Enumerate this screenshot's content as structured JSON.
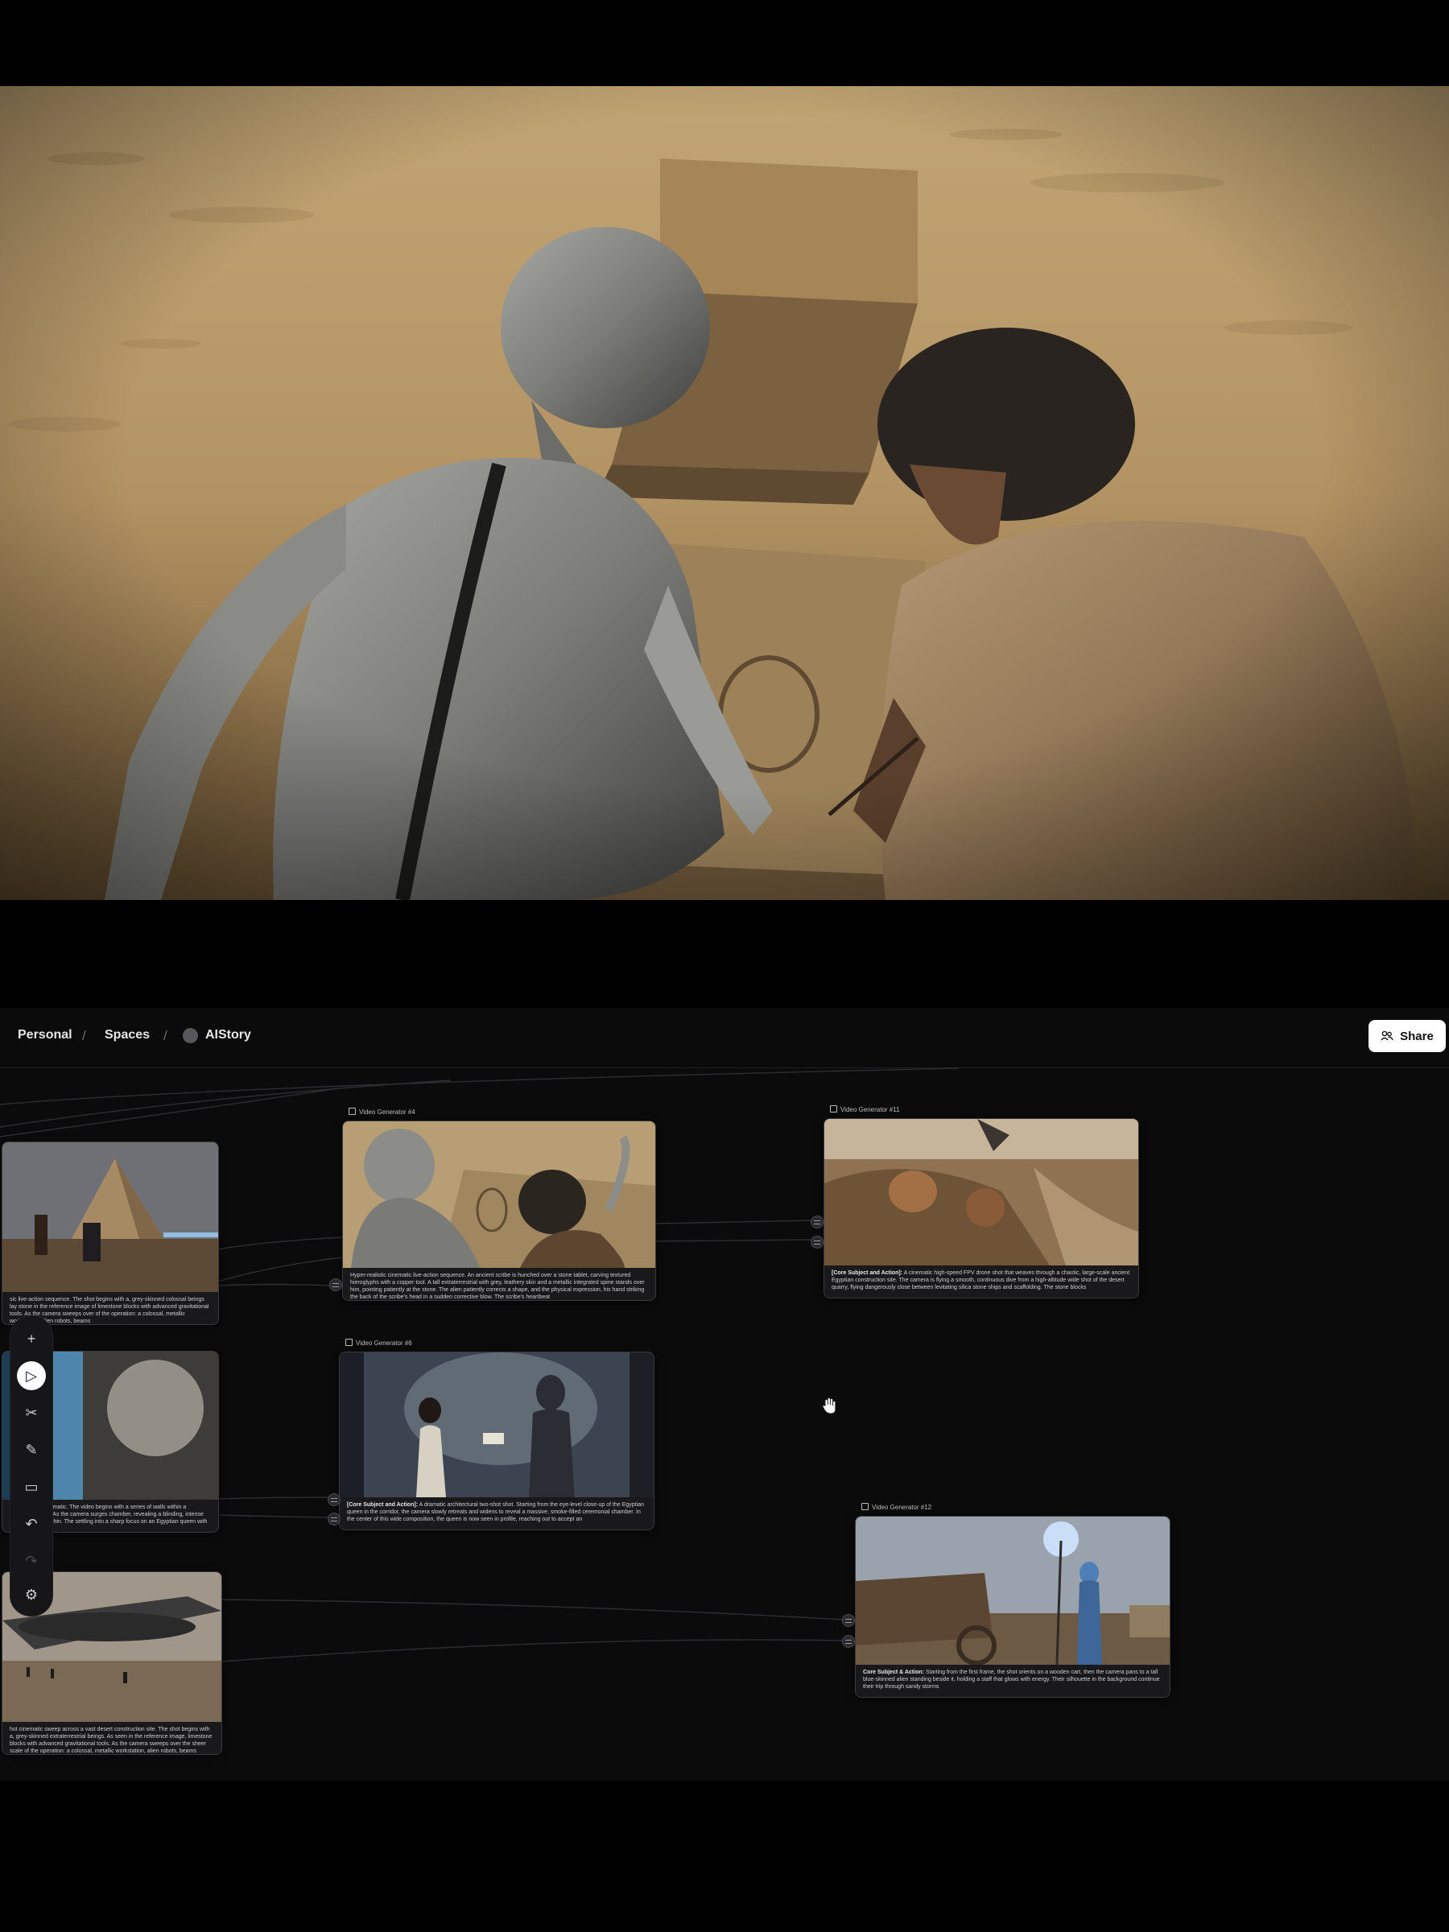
{
  "breadcrumb": {
    "items": [
      "Personal",
      "Spaces",
      "AIStory"
    ],
    "separator": "/"
  },
  "share": {
    "label": "Share",
    "icon": "users-icon"
  },
  "nodes": {
    "video_generator_4": {
      "title": "Video Generator #4",
      "caption_lead": "",
      "caption": "Hyper-realistic cinematic live-action sequence. An ancient scribe is hunched over a stone tablet, carving textured hieroglyphs with a copper tool. A tall extraterrestrial with grey, leathery skin and a metallic integrated spine stands over him, pointing patiently at the stone. The alien patiently corrects a shape, and the physical expression, his hand striking the back of the scribe's head in a sudden corrective blow. The scribe's heartbeat"
    },
    "video_generator_11": {
      "title": "Video Generator #11",
      "caption_lead": "[Core Subject and Action]:",
      "caption": "A cinematic high-speed FPV drone shot that weaves through a chaotic, large-scale ancient Egyptian construction site. The camera is flying a smooth, continuous dive from a high-altitude wide shot of the desert quarry, flying dangerously close between levitating silica stone ships and scaffolding. The stone blocks"
    },
    "video_generator_6": {
      "title": "Video Generator #6",
      "caption_lead": "[Core Subject and Action]:",
      "caption": "A dramatic architectural two-shot shot. Starting from the eye-level close-up of the Egyptian queen in the corridor, the camera slowly retreats and widens to reveal a massive, smoke-filled ceremonial chamber. In the center of this wide composition, the queen is now seen in profile, reaching out to accept an"
    },
    "video_generator_12": {
      "title": "Video Generator #12",
      "caption_lead": "Core Subject & Action:",
      "caption": "Starting from the first frame, the shot orients on a wooden cart, then the camera pans to a tall blue-skinned alien standing beside it, holding a staff that glows with energy. Their silhouette in the background continue their trip through sandy storms"
    },
    "left_top": {
      "caption": "sic live-action sequence. The shot begins with a, grey-skinned colossal beings lay stone in the reference image of limestone blocks with advanced gravitational tools. As the camera sweeps over of the operation: a colossal, metallic workstation, alien robots, beams"
    },
    "left_mid": {
      "caption": "known shots cinematic. The video begins with a series of walls within a cavernous tomb. As the camera surges chamber, revealing a blinding, intense blue light from within. The settling into a sharp focus on an Egyptian queen with"
    },
    "left_bottom": {
      "caption": "hot cinematic sweep across a vast desert construction site. The shot begins with a, grey-skinned extraterrestrial beings. As seen in the reference image, limestone blocks with advanced gravitational tools. As the camera sweeps over the sheer scale of the operation: a colossal, metallic workstation, alien robots, beams"
    }
  },
  "toolbar": [
    {
      "name": "add-icon",
      "label": "+"
    },
    {
      "name": "play-cursor-icon",
      "label": "▷",
      "active": true
    },
    {
      "name": "scissors-icon",
      "label": "✂"
    },
    {
      "name": "pen-icon",
      "label": "✎"
    },
    {
      "name": "comment-icon",
      "label": "▭"
    },
    {
      "name": "undo-icon",
      "label": "↶"
    },
    {
      "name": "redo-icon",
      "label": "↷",
      "disabled": true
    },
    {
      "name": "settings-icon",
      "label": "⚙"
    }
  ],
  "colors": {
    "canvas_bg": "#0b0b0c",
    "wire": "#3a3a3f",
    "share_bg": "#ffffff"
  }
}
